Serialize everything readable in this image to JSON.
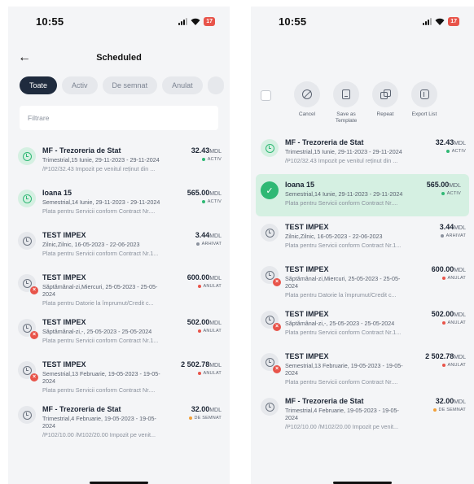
{
  "colors": {
    "accent_dark": "#1f2b3e",
    "green_active": "#2fb874",
    "gray_archived": "#8a919d",
    "red_cancelled": "#e8544a",
    "orange_pending": "#f2a03a"
  },
  "left": {
    "status": {
      "time": "10:55",
      "battery": "17"
    },
    "title": "Scheduled",
    "chips": [
      "Toate",
      "Activ",
      "De semnat",
      "Anulat"
    ],
    "filter_placeholder": "Filtrare",
    "items": [
      {
        "icon": "green",
        "badge": false,
        "name": "MF - Trezoreria de Stat",
        "amount": "32.43",
        "currency": "MDL",
        "status": "ACTIV",
        "status_color": "#2fb874",
        "schedule": "Trimestrial,15 Iunie, 29-11-2023 - 29-11-2024",
        "desc": "/P102/32.43 Impozit pe venitul reținut din ..."
      },
      {
        "icon": "green",
        "badge": false,
        "name": "Ioana 15",
        "amount": "565.00",
        "currency": "MDL",
        "status": "ACTIV",
        "status_color": "#2fb874",
        "schedule": "Semestrial,14 Iunie, 29-11-2023 - 29-11-2024",
        "desc": "Plata pentru Servicii conform Contract Nr...."
      },
      {
        "icon": "gray",
        "badge": false,
        "name": "TEST IMPEX",
        "amount": "3.44",
        "currency": "MDL",
        "status": "ARHIVAT",
        "status_color": "#8a919d",
        "schedule": "Zilnic,Zilnic, 16-05-2023 - 22-06-2023",
        "desc": "Plata pentru Servicii conform Contract Nr.1..."
      },
      {
        "icon": "gray",
        "badge": true,
        "name": "TEST IMPEX",
        "amount": "600.00",
        "currency": "MDL",
        "status": "ANULAT",
        "status_color": "#e8544a",
        "schedule": "Săptămânal-zi,Miercuri, 25-05-2023 - 25-05-2024",
        "desc": "Plata pentru Datorie la împrumut/Credit c..."
      },
      {
        "icon": "gray",
        "badge": true,
        "name": "TEST IMPEX",
        "amount": "502.00",
        "currency": "MDL",
        "status": "ANULAT",
        "status_color": "#e8544a",
        "schedule": "Săptămânal-zi,-, 25-05-2023 - 25-05-2024",
        "desc": "Plata pentru Servicii conform Contract Nr.1..."
      },
      {
        "icon": "gray",
        "badge": true,
        "name": "TEST IMPEX",
        "amount": "2 502.78",
        "currency": "MDL",
        "status": "ANULAT",
        "status_color": "#e8544a",
        "schedule": "Semestrial,13 Februarie, 19-05-2023 - 19-05-2024",
        "desc": "Plata pentru Servicii conform Contract Nr...."
      },
      {
        "icon": "gray",
        "badge": false,
        "name": "MF - Trezoreria de Stat",
        "amount": "32.00",
        "currency": "MDL",
        "status": "DE SEMNAT",
        "status_color": "#f2a03a",
        "schedule": "Trimestrial,4 Februarie, 19-05-2023 - 19-05-2024",
        "desc": "/P102/10.00 /M102/20.00 Impozit pe venit..."
      }
    ]
  },
  "right": {
    "status": {
      "time": "10:55",
      "battery": "17"
    },
    "actions": [
      {
        "label": "Cancel",
        "icon": "cancel-icon"
      },
      {
        "label": "Save as Template",
        "icon": "save-template-icon"
      },
      {
        "label": "Repeat",
        "icon": "repeat-icon"
      },
      {
        "label": "Export List",
        "icon": "export-icon"
      }
    ],
    "items": [
      {
        "icon": "green",
        "badge": false,
        "selected": false,
        "name": "MF - Trezoreria de Stat",
        "amount": "32.43",
        "currency": "MDL",
        "status": "ACTIV",
        "status_color": "#2fb874",
        "schedule": "Trimestrial,15 Iunie, 29-11-2023 - 29-11-2024",
        "desc": "/P102/32.43 Impozit pe venitul reținut din ..."
      },
      {
        "icon": "selected",
        "badge": false,
        "selected": true,
        "name": "Ioana 15",
        "amount": "565.00",
        "currency": "MDL",
        "status": "ACTIV",
        "status_color": "#2fb874",
        "schedule": "Semestrial,14 Iunie, 29-11-2023 - 29-11-2024",
        "desc": "Plata pentru Servicii conform Contract Nr...."
      },
      {
        "icon": "gray",
        "badge": false,
        "selected": false,
        "name": "TEST IMPEX",
        "amount": "3.44",
        "currency": "MDL",
        "status": "ARHIVAT",
        "status_color": "#8a919d",
        "schedule": "Zilnic,Zilnic, 16-05-2023 - 22-06-2023",
        "desc": "Plata pentru Servicii conform Contract Nr.1..."
      },
      {
        "icon": "gray",
        "badge": true,
        "selected": false,
        "name": "TEST IMPEX",
        "amount": "600.00",
        "currency": "MDL",
        "status": "ANULAT",
        "status_color": "#e8544a",
        "schedule": "Săptămânal-zi,Miercuri, 25-05-2023 - 25-05-2024",
        "desc": "Plata pentru Datorie la împrumut/Credit c..."
      },
      {
        "icon": "gray",
        "badge": true,
        "selected": false,
        "name": "TEST IMPEX",
        "amount": "502.00",
        "currency": "MDL",
        "status": "ANULAT",
        "status_color": "#e8544a",
        "schedule": "Săptămânal-zi,-, 25-05-2023 - 25-05-2024",
        "desc": "Plata pentru Servicii conform Contract Nr.1..."
      },
      {
        "icon": "gray",
        "badge": true,
        "selected": false,
        "name": "TEST IMPEX",
        "amount": "2 502.78",
        "currency": "MDL",
        "status": "ANULAT",
        "status_color": "#e8544a",
        "schedule": "Semestrial,13 Februarie, 19-05-2023 - 19-05-2024",
        "desc": "Plata pentru Servicii conform Contract Nr...."
      },
      {
        "icon": "gray",
        "badge": false,
        "selected": false,
        "name": "MF - Trezoreria de Stat",
        "amount": "32.00",
        "currency": "MDL",
        "status": "DE SEMNAT",
        "status_color": "#f2a03a",
        "schedule": "Trimestrial,4 Februarie, 19-05-2023 - 19-05-2024",
        "desc": "/P102/10.00 /M102/20.00 Impozit pe venit..."
      }
    ]
  }
}
